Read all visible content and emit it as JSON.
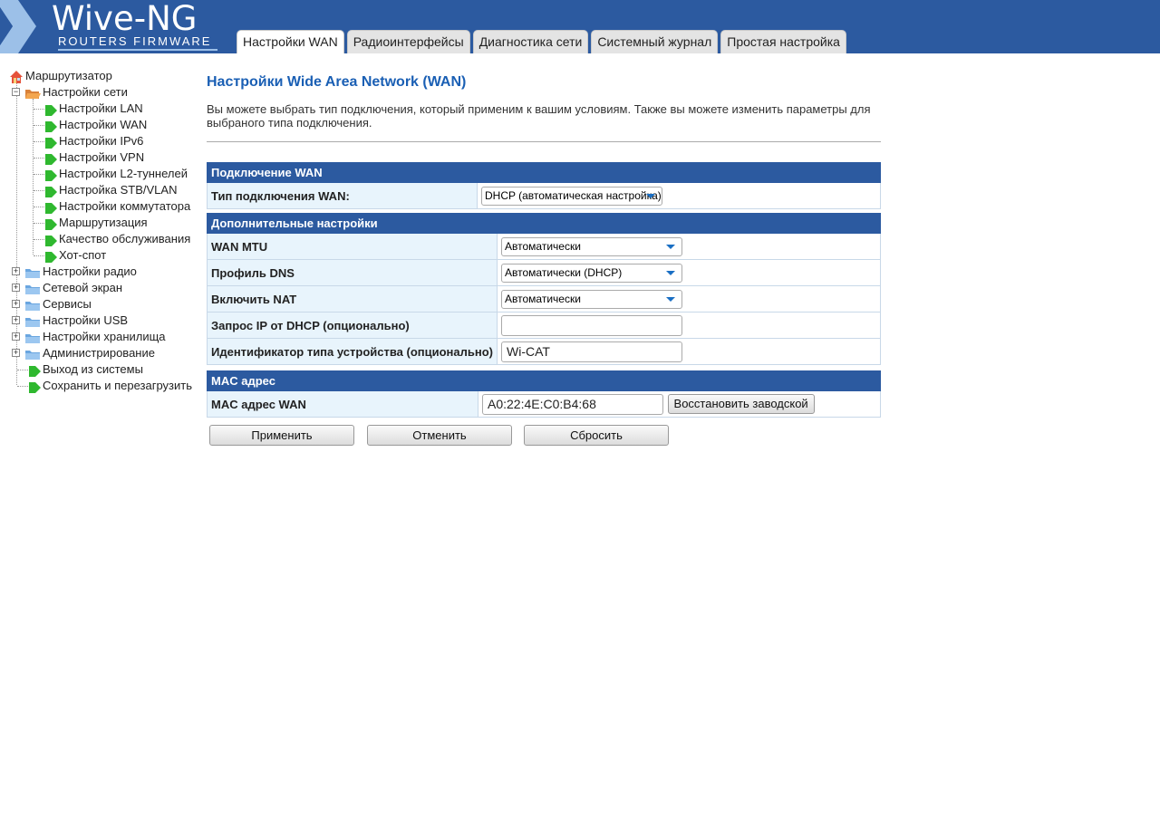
{
  "header": {
    "logo_title": "Wive-NG",
    "logo_subtitle": "ROUTERS FIRMWARE",
    "brand_color": "#2c5aa0",
    "tabs": [
      {
        "label": "Настройки WAN",
        "active": true
      },
      {
        "label": "Радиоинтерфейсы",
        "active": false
      },
      {
        "label": "Диагностика сети",
        "active": false
      },
      {
        "label": "Системный журнал",
        "active": false
      },
      {
        "label": "Простая настройка",
        "active": false
      }
    ]
  },
  "sidebar": {
    "root": {
      "label": "Маршрутизатор",
      "icon": "home-icon"
    },
    "items": [
      {
        "label": "Настройки сети",
        "icon": "folder-open-icon",
        "expanded": true
      },
      {
        "label": "Настройки LAN",
        "icon": "page-arrow-icon"
      },
      {
        "label": "Настройки WAN",
        "icon": "page-arrow-icon"
      },
      {
        "label": "Настройки IPv6",
        "icon": "page-arrow-icon"
      },
      {
        "label": "Настройки VPN",
        "icon": "page-arrow-icon"
      },
      {
        "label": "Настройки L2-туннелей",
        "icon": "page-arrow-icon"
      },
      {
        "label": "Настройка STB/VLAN",
        "icon": "page-arrow-icon"
      },
      {
        "label": "Настройки коммутатора",
        "icon": "page-arrow-icon"
      },
      {
        "label": "Маршрутизация",
        "icon": "page-arrow-icon"
      },
      {
        "label": "Качество обслуживания",
        "icon": "page-arrow-icon"
      },
      {
        "label": "Хот-спот",
        "icon": "page-arrow-icon"
      },
      {
        "label": "Настройки радио",
        "icon": "folder-icon",
        "expanded": false
      },
      {
        "label": "Сетевой экран",
        "icon": "folder-icon",
        "expanded": false
      },
      {
        "label": "Сервисы",
        "icon": "folder-icon",
        "expanded": false
      },
      {
        "label": "Настройки USB",
        "icon": "folder-icon",
        "expanded": false
      },
      {
        "label": "Настройки хранилища",
        "icon": "folder-icon",
        "expanded": false
      },
      {
        "label": "Администрирование",
        "icon": "folder-icon",
        "expanded": false
      },
      {
        "label": "Выход из системы",
        "icon": "page-arrow-icon"
      },
      {
        "label": "Сохранить и перезагрузить",
        "icon": "page-arrow-icon"
      }
    ]
  },
  "main": {
    "title": "Настройки Wide Area Network (WAN)",
    "description": "Вы можете выбрать тип подключения, который применим к вашим условиям. Также вы можете изменить параметры для выбраного типа подключения.",
    "wan_section": {
      "header": "Подключение WAN",
      "type_label": "Тип подключения WAN:",
      "type_value": "DHCP (автоматическая настройка)"
    },
    "extra_section": {
      "header": "Дополнительные настройки",
      "mtu_label": "WAN MTU",
      "mtu_value": "Автоматически",
      "dns_label": "Профиль DNS",
      "dns_value": "Автоматически (DHCP)",
      "nat_label": "Включить NAT",
      "nat_value": "Автоматически",
      "dhcp_ip_label": "Запрос IP от DHCP (опционально)",
      "dhcp_ip_value": "",
      "vendor_label": "Идентификатор типа устройства (опционально)",
      "vendor_value": "Wi-CAT"
    },
    "mac_section": {
      "header": "MAC адрес",
      "mac_label": "MAC адрес WAN",
      "mac_value": "A0:22:4E:C0:B4:68",
      "restore_label": "Восстановить заводской"
    },
    "buttons": {
      "apply": "Применить",
      "cancel": "Отменить",
      "reset": "Сбросить"
    }
  }
}
